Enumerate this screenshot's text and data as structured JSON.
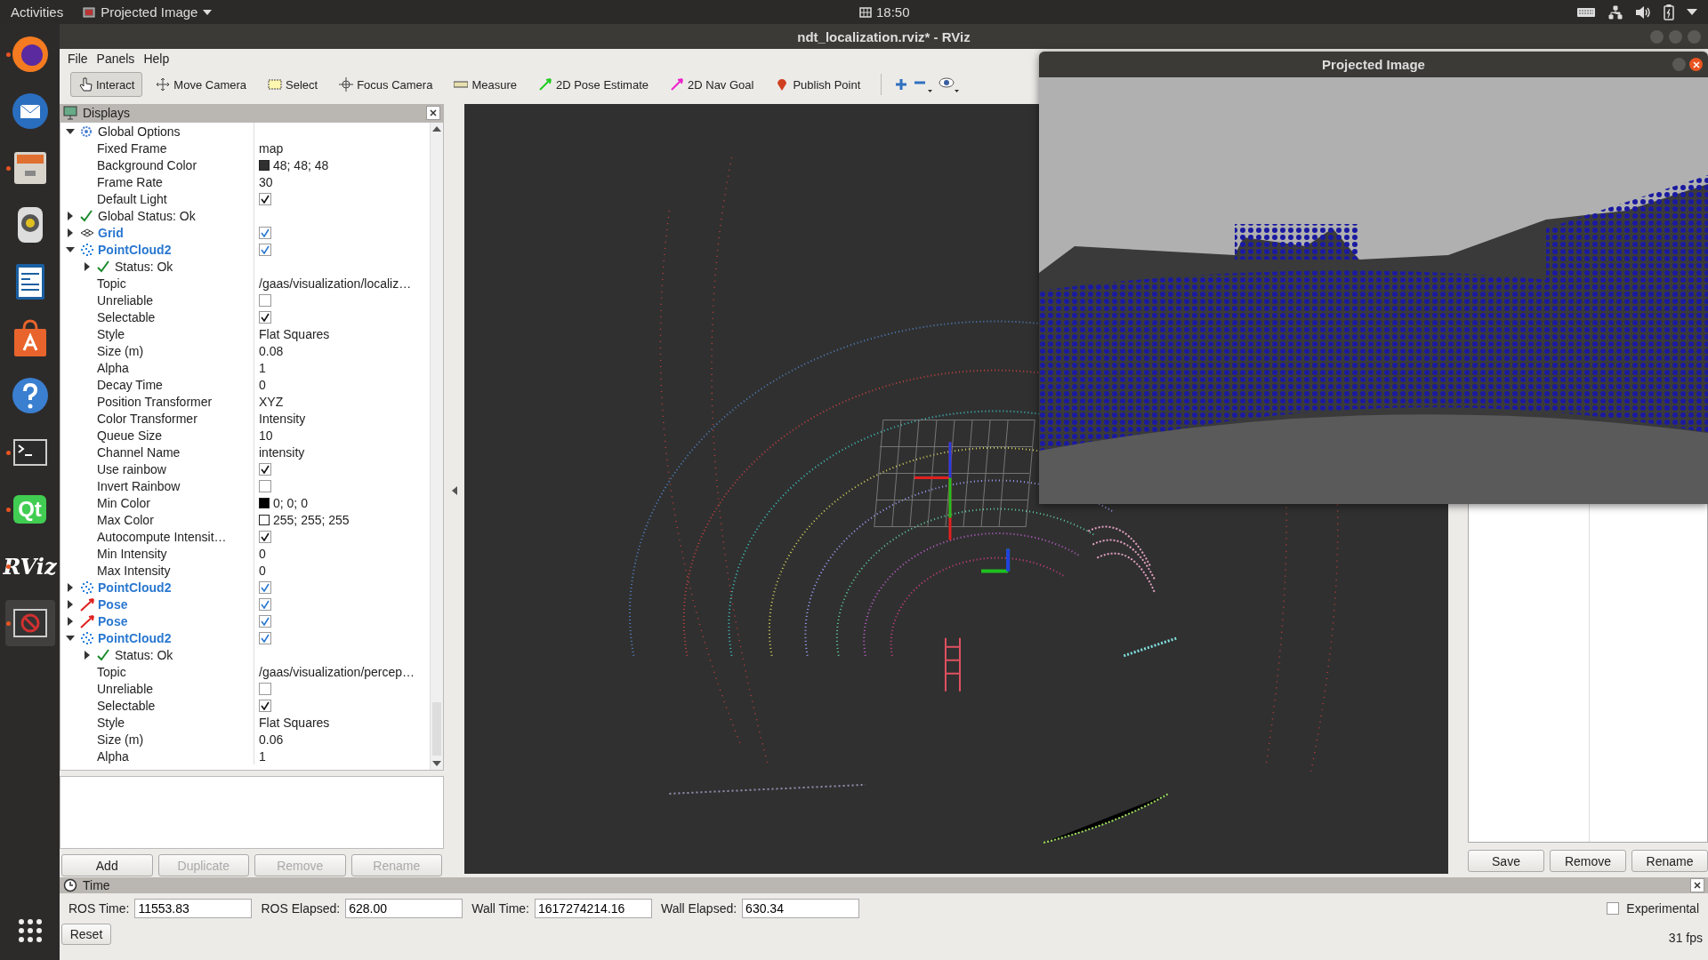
{
  "topbar": {
    "activities": "Activities",
    "app_menu": "Projected Image",
    "clock": "18:50"
  },
  "dock": [
    {
      "kind": "firefox",
      "running": true
    },
    {
      "kind": "mail",
      "running": false
    },
    {
      "kind": "files",
      "running": true
    },
    {
      "kind": "speaker",
      "running": false
    },
    {
      "kind": "writer",
      "running": false
    },
    {
      "kind": "store",
      "running": false
    },
    {
      "kind": "help",
      "running": false
    },
    {
      "kind": "terminal",
      "running": true
    },
    {
      "kind": "qt",
      "label": "Qt",
      "running": true
    },
    {
      "kind": "rviz",
      "label": "RViz",
      "running": true
    },
    {
      "kind": "blocked",
      "running": true
    }
  ],
  "window": {
    "title": "ndt_localization.rviz* - RViz"
  },
  "menu": [
    "File",
    "Panels",
    "Help"
  ],
  "tools": [
    {
      "kind": "interact",
      "label": "Interact",
      "selected": true
    },
    {
      "kind": "move",
      "label": "Move Camera",
      "selected": false
    },
    {
      "kind": "select",
      "label": "Select",
      "selected": false
    },
    {
      "kind": "focus",
      "label": "Focus Camera",
      "selected": false
    },
    {
      "kind": "measure",
      "label": "Measure",
      "selected": false
    },
    {
      "kind": "pose",
      "label": "2D Pose Estimate",
      "selected": false
    },
    {
      "kind": "nav",
      "label": "2D Nav Goal",
      "selected": false
    },
    {
      "kind": "point",
      "label": "Publish Point",
      "selected": false
    }
  ],
  "displays": {
    "title": "Displays",
    "tree": [
      {
        "kind": "options",
        "label": "Global Options",
        "expanded": true,
        "children": [
          {
            "kind": "text",
            "label": "Fixed Frame",
            "value": "map"
          },
          {
            "kind": "color",
            "label": "Background Color",
            "value": "48; 48; 48",
            "color": "#303030"
          },
          {
            "kind": "text",
            "label": "Frame Rate",
            "value": "30"
          },
          {
            "kind": "check",
            "label": "Default Light",
            "checked": true
          }
        ]
      },
      {
        "kind": "status",
        "label": "Global Status: Ok",
        "expanded": false
      },
      {
        "kind": "grid",
        "label": "Grid",
        "expanded": false,
        "checked": true
      },
      {
        "kind": "cloud",
        "label": "PointCloud2",
        "expanded": true,
        "checked": true,
        "children": [
          {
            "kind": "status",
            "label": "Status: Ok",
            "expanded": false
          },
          {
            "kind": "text",
            "label": "Topic",
            "value": "/gaas/visualization/localiz…"
          },
          {
            "kind": "check",
            "label": "Unreliable",
            "checked": false
          },
          {
            "kind": "check",
            "label": "Selectable",
            "checked": true
          },
          {
            "kind": "text",
            "label": "Style",
            "value": "Flat Squares"
          },
          {
            "kind": "text",
            "label": "Size (m)",
            "value": "0.08"
          },
          {
            "kind": "text",
            "label": "Alpha",
            "value": "1"
          },
          {
            "kind": "text",
            "label": "Decay Time",
            "value": "0"
          },
          {
            "kind": "text",
            "label": "Position Transformer",
            "value": "XYZ"
          },
          {
            "kind": "text",
            "label": "Color Transformer",
            "value": "Intensity"
          },
          {
            "kind": "text",
            "label": "Queue Size",
            "value": "10"
          },
          {
            "kind": "text",
            "label": "Channel Name",
            "value": "intensity"
          },
          {
            "kind": "check",
            "label": "Use rainbow",
            "checked": true
          },
          {
            "kind": "check",
            "label": "Invert Rainbow",
            "checked": false
          },
          {
            "kind": "color",
            "label": "Min Color",
            "value": "0; 0; 0",
            "color": "#000000"
          },
          {
            "kind": "color",
            "label": "Max Color",
            "value": "255; 255; 255",
            "color": "#ffffff"
          },
          {
            "kind": "check",
            "label": "Autocompute Intensit…",
            "checked": true
          },
          {
            "kind": "text",
            "label": "Min Intensity",
            "value": "0"
          },
          {
            "kind": "text",
            "label": "Max Intensity",
            "value": "0"
          }
        ]
      },
      {
        "kind": "cloud",
        "label": "PointCloud2",
        "expanded": false,
        "checked": true
      },
      {
        "kind": "pose",
        "label": "Pose",
        "expanded": false,
        "checked": true
      },
      {
        "kind": "pose",
        "label": "Pose",
        "expanded": false,
        "checked": true
      },
      {
        "kind": "cloud",
        "label": "PointCloud2",
        "expanded": true,
        "checked": true,
        "children": [
          {
            "kind": "status",
            "label": "Status: Ok",
            "expanded": false
          },
          {
            "kind": "text",
            "label": "Topic",
            "value": "/gaas/visualization/percep…"
          },
          {
            "kind": "check",
            "label": "Unreliable",
            "checked": false
          },
          {
            "kind": "check",
            "label": "Selectable",
            "checked": true
          },
          {
            "kind": "text",
            "label": "Style",
            "value": "Flat Squares"
          },
          {
            "kind": "text",
            "label": "Size (m)",
            "value": "0.06"
          },
          {
            "kind": "text",
            "label": "Alpha",
            "value": "1"
          }
        ]
      }
    ],
    "buttons": [
      {
        "label": "Add",
        "disabled": false
      },
      {
        "label": "Duplicate",
        "disabled": true
      },
      {
        "label": "Remove",
        "disabled": true
      },
      {
        "label": "Rename",
        "disabled": true
      }
    ]
  },
  "projected_window": {
    "title": "Projected Image"
  },
  "views": {
    "buttons": [
      "Save",
      "Remove",
      "Rename"
    ]
  },
  "time": {
    "title": "Time",
    "fields": [
      {
        "label": "ROS Time:",
        "value": "11553.83"
      },
      {
        "label": "ROS Elapsed:",
        "value": "628.00"
      },
      {
        "label": "Wall Time:",
        "value": "1617274214.16"
      },
      {
        "label": "Wall Elapsed:",
        "value": "630.34"
      }
    ],
    "experimental": {
      "label": "Experimental",
      "checked": false
    },
    "reset": "Reset",
    "fps": "31 fps"
  }
}
